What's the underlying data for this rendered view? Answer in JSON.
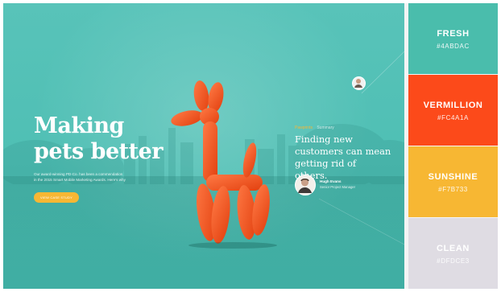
{
  "hero": {
    "headline_line1": "Making",
    "headline_line2": "pets better",
    "subtext_line1": "Our award-winning PD-Co. has been a commendation",
    "subtext_line2": "in the 2015 Smart Mobile Marketing Awards. Here's why",
    "cta_label": "VIEW CASE STUDY",
    "colors": {
      "background": "#4FBFB4",
      "balloon": "#FC4A1A",
      "cta": "#F7B733"
    }
  },
  "testimonial": {
    "tag_primary": "Pawprints",
    "tag_secondary": "Summary",
    "quote_line1": "Finding new",
    "quote_line2": "customers can mean",
    "quote_line3": "getting rid of others.",
    "author_name": "Hugh Evans",
    "author_role": "Senior Project Manager"
  },
  "palette": [
    {
      "name": "FRESH",
      "hex": "#4ABDAC",
      "color": "#4ABDAC"
    },
    {
      "name": "VERMILLION",
      "hex": "#FC4A1A",
      "color": "#FC4A1A"
    },
    {
      "name": "SUNSHINE",
      "hex": "#F7B733",
      "color": "#F7B733"
    },
    {
      "name": "CLEAN",
      "hex": "#DFDCE3",
      "color": "#DFDCE3"
    }
  ]
}
